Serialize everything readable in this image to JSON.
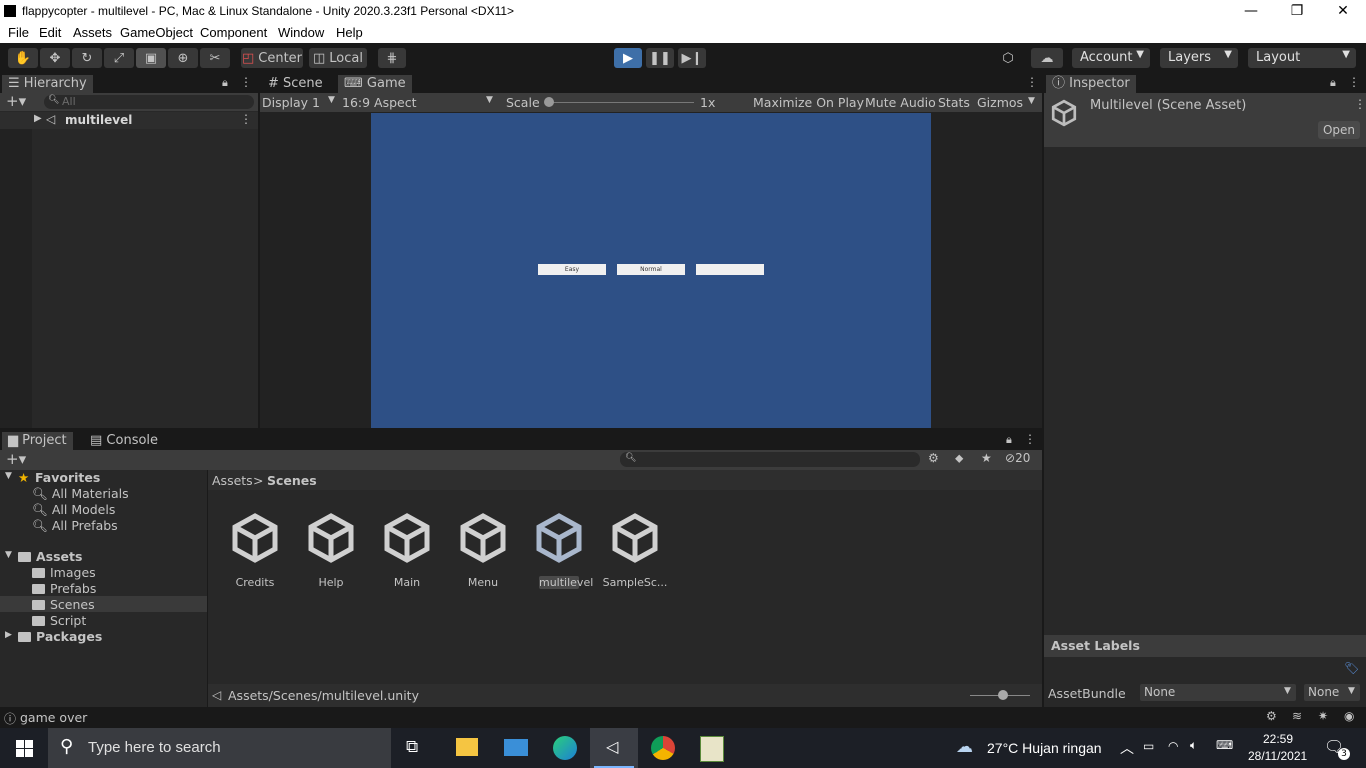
{
  "window": {
    "title": "flappycopter - multilevel - PC, Mac & Linux Standalone - Unity 2020.3.23f1 Personal <DX11>",
    "controls": {
      "minimize": "—",
      "restore": "❐",
      "close": "✕"
    }
  },
  "menubar": [
    "File",
    "Edit",
    "Assets",
    "GameObject",
    "Component",
    "Window",
    "Help"
  ],
  "toolbar": {
    "pivot": "Center",
    "space": "Local",
    "account": "Account",
    "layers": "Layers",
    "layout": "Layout"
  },
  "hierarchy": {
    "tab": "Hierarchy",
    "search_placeholder": "All",
    "scene": "multilevel"
  },
  "game_view": {
    "tabs": [
      "Scene",
      "Game"
    ],
    "display": "Display 1",
    "aspect": "16:9 Aspect",
    "scale_label": "Scale",
    "scale_value": "1x",
    "buttons": [
      "Maximize On Play",
      "Mute Audio",
      "Stats",
      "Gizmos"
    ],
    "game_buttons": [
      "Easy",
      "Normal",
      ""
    ],
    "background": "#2e5086"
  },
  "inspector": {
    "tab": "Inspector",
    "title": "Multilevel (Scene Asset)",
    "open_button": "Open",
    "asset_labels": "Asset Labels",
    "asset_bundle_label": "AssetBundle",
    "asset_bundle_value": "None",
    "asset_bundle_variant": "None"
  },
  "project": {
    "tabs": [
      "Project",
      "Console"
    ],
    "hidden_count": "20",
    "favorites": {
      "label": "Favorites",
      "items": [
        "All Materials",
        "All Models",
        "All Prefabs"
      ]
    },
    "assets": {
      "label": "Assets",
      "items": [
        "Images",
        "Prefabs",
        "Scenes",
        "Script"
      ]
    },
    "packages": "Packages",
    "breadcrumb": [
      "Assets",
      "Scenes"
    ],
    "files": [
      "Credits",
      "Help",
      "Main",
      "Menu",
      "multilevel",
      "SampleSc..."
    ],
    "path": "Assets/Scenes/multilevel.unity"
  },
  "status": {
    "message": "game over"
  },
  "taskbar": {
    "search_placeholder": "Type here to search",
    "weather": "27°C  Hujan ringan",
    "time": "22:59",
    "date": "28/11/2021",
    "notifications": "3"
  }
}
